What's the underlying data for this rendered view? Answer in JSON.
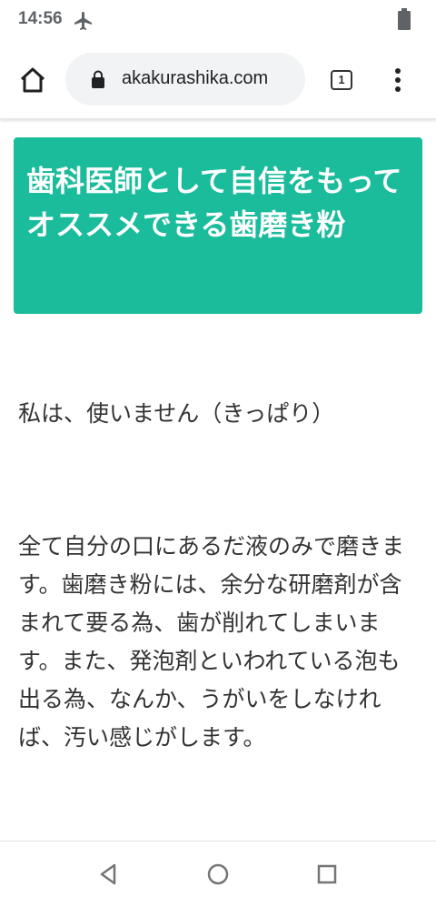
{
  "status_bar": {
    "time": "14:56",
    "icons": [
      "airplane-icon",
      "battery-icon"
    ]
  },
  "browser": {
    "url": "akakurashika.com",
    "tab_count": "1",
    "icons": [
      "home-icon",
      "lock-icon",
      "menu-icon"
    ]
  },
  "article": {
    "title": "歯科医師として自信をもってオススメできる歯磨き粉",
    "paragraphs": [
      "私は、使いません（きっぱり）",
      "全て自分の口にあるだ液のみで磨きます。歯磨き粉には、余分な研磨剤が含まれて要る為、歯が削れてしまいます。また、発泡剤といわれている泡も出る為、なんか、うがいをしなければ、汚い感じがします。"
    ]
  },
  "nav_bar": {
    "icons": [
      "back-icon",
      "home-circle-icon",
      "recents-icon"
    ]
  },
  "colors": {
    "title_card_bg": "#1abc9c",
    "url_pill_bg": "#f1f3f4",
    "status_icon": "#5f6368"
  }
}
